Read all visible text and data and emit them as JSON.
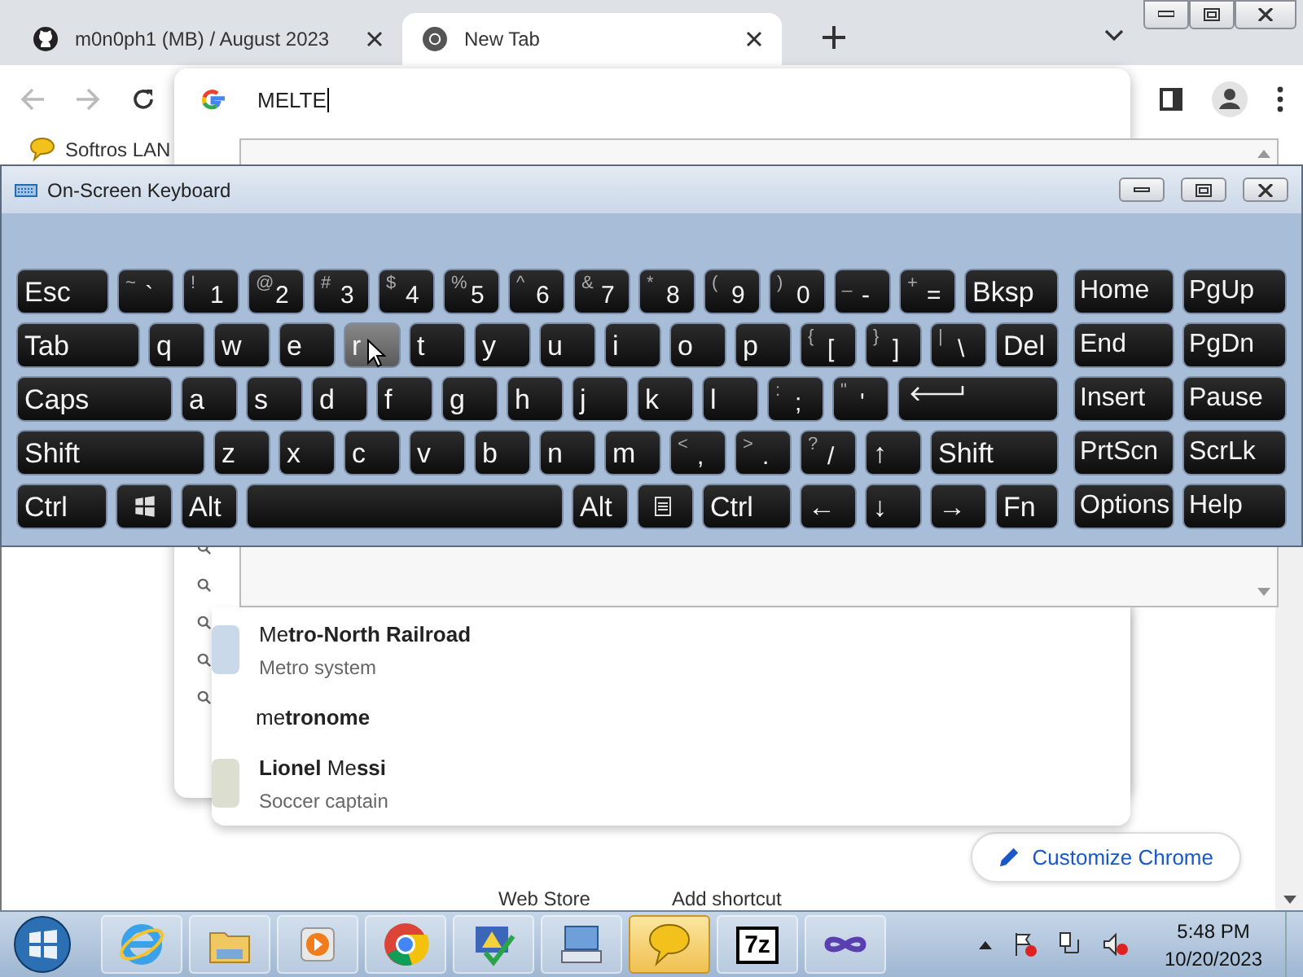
{
  "browser": {
    "tabs": [
      {
        "title": "m0n0ph1 (MB) / August 2023",
        "selected": false
      },
      {
        "title": "New Tab",
        "selected": true
      }
    ],
    "omnibox": {
      "value": "MELTE"
    },
    "bookmarks": [
      {
        "label": "Softros LAN"
      }
    ],
    "suggestions": [
      {
        "kind": "entity",
        "title": "Me**tro-North Railroad**",
        "subtitle": "Metro system",
        "color": "#c9d9ea"
      },
      {
        "kind": "search",
        "title": "me**tronome**"
      },
      {
        "kind": "entity",
        "title": "**Lionel** Me**ssi**",
        "subtitle": "Soccer captain",
        "color": "#dcdfd0"
      }
    ],
    "customize_button": "Customize Chrome",
    "shortcuts": [
      {
        "label": "Web Store"
      },
      {
        "label": "Add shortcut"
      }
    ]
  },
  "keyboard": {
    "title": "On-Screen Keyboard",
    "rows": [
      {
        "keys": [
          {
            "label": "Esc",
            "hovered": false
          },
          {
            "label": "`",
            "shift": "~",
            "hovered": false
          },
          {
            "label": "1",
            "shift": "!",
            "hovered": false
          },
          {
            "label": "2",
            "shift": "@",
            "hovered": false
          },
          {
            "label": "3",
            "shift": "#",
            "hovered": false
          },
          {
            "label": "4",
            "shift": "$",
            "hovered": false
          },
          {
            "label": "5",
            "shift": "%",
            "hovered": false
          },
          {
            "label": "6",
            "shift": "^",
            "hovered": false
          },
          {
            "label": "7",
            "shift": "&",
            "hovered": false
          },
          {
            "label": "8",
            "shift": "*",
            "hovered": false
          },
          {
            "label": "9",
            "shift": "(",
            "hovered": false
          },
          {
            "label": "0",
            "shift": ")",
            "hovered": false
          },
          {
            "label": "-",
            "shift": "_",
            "hovered": false
          },
          {
            "label": "=",
            "shift": "+",
            "hovered": false
          },
          {
            "label": "Bksp",
            "hovered": false
          }
        ]
      },
      {
        "keys": [
          {
            "label": "Tab",
            "hovered": false
          },
          {
            "label": "q",
            "hovered": false
          },
          {
            "label": "w",
            "hovered": false
          },
          {
            "label": "e",
            "hovered": false
          },
          {
            "label": "r",
            "hovered": true
          },
          {
            "label": "t",
            "hovered": false
          },
          {
            "label": "y",
            "hovered": false
          },
          {
            "label": "u",
            "hovered": false
          },
          {
            "label": "i",
            "hovered": false
          },
          {
            "label": "o",
            "hovered": false
          },
          {
            "label": "p",
            "hovered": false
          },
          {
            "label": "[",
            "shift": "{",
            "hovered": false
          },
          {
            "label": "]",
            "shift": "}",
            "hovered": false
          },
          {
            "label": "\\",
            "shift": "|",
            "hovered": false
          },
          {
            "label": "Del",
            "hovered": false
          }
        ]
      },
      {
        "keys": [
          {
            "label": "Caps",
            "hovered": false
          },
          {
            "label": "a",
            "hovered": false
          },
          {
            "label": "s",
            "hovered": false
          },
          {
            "label": "d",
            "hovered": false
          },
          {
            "label": "f",
            "hovered": false
          },
          {
            "label": "g",
            "hovered": false
          },
          {
            "label": "h",
            "hovered": false
          },
          {
            "label": "j",
            "hovered": false
          },
          {
            "label": "k",
            "hovered": false
          },
          {
            "label": "l",
            "hovered": false
          },
          {
            "label": ";",
            "shift": ":",
            "hovered": false
          },
          {
            "label": "'",
            "shift": "\"",
            "hovered": false
          },
          {
            "kind": "enter",
            "hovered": false
          }
        ]
      },
      {
        "keys": [
          {
            "label": "Shift",
            "hovered": false
          },
          {
            "label": "z",
            "hovered": false
          },
          {
            "label": "x",
            "hovered": false
          },
          {
            "label": "c",
            "hovered": false
          },
          {
            "label": "v",
            "hovered": false
          },
          {
            "label": "b",
            "hovered": false
          },
          {
            "label": "n",
            "hovered": false
          },
          {
            "label": "m",
            "hovered": false
          },
          {
            "label": ",",
            "shift": "<",
            "hovered": false
          },
          {
            "label": ".",
            "shift": ">",
            "hovered": false
          },
          {
            "label": "/",
            "shift": "?",
            "hovered": false
          },
          {
            "label": "↑",
            "hovered": false
          },
          {
            "label": "Shift",
            "hovered": false
          }
        ]
      },
      {
        "keys": [
          {
            "label": "Ctrl",
            "hovered": false
          },
          {
            "kind": "win",
            "hovered": false
          },
          {
            "label": "Alt",
            "hovered": false
          },
          {
            "kind": "space",
            "hovered": false
          },
          {
            "label": "Alt",
            "hovered": false
          },
          {
            "kind": "menu",
            "hovered": false
          },
          {
            "label": "Ctrl",
            "hovered": false
          },
          {
            "label": "←",
            "hovered": false
          },
          {
            "label": "↓",
            "hovered": false
          },
          {
            "label": "→",
            "hovered": false
          },
          {
            "label": "Fn",
            "hovered": false
          }
        ]
      }
    ],
    "side_rows": [
      [
        {
          "label": "Home",
          "hovered": false
        },
        {
          "label": "PgUp",
          "hovered": false
        }
      ],
      [
        {
          "label": "End",
          "hovered": false
        },
        {
          "label": "PgDn",
          "hovered": false
        }
      ],
      [
        {
          "label": "Insert",
          "hovered": false
        },
        {
          "label": "Pause",
          "hovered": false
        }
      ],
      [
        {
          "label": "PrtScn",
          "hovered": false
        },
        {
          "label": "ScrLk",
          "hovered": false
        }
      ],
      [
        {
          "label": "Options",
          "hovered": false
        },
        {
          "label": "Help",
          "hovered": false
        }
      ]
    ]
  },
  "taskbar": {
    "apps": [
      {
        "kind": "ie",
        "selected": false
      },
      {
        "kind": "folder",
        "selected": false
      },
      {
        "kind": "media",
        "selected": false
      },
      {
        "kind": "chrome",
        "selected": false
      },
      {
        "kind": "security",
        "selected": false
      },
      {
        "kind": "keyboard",
        "selected": false
      },
      {
        "kind": "chat",
        "selected": true
      },
      {
        "kind": "zip",
        "label": "7z",
        "selected": false
      },
      {
        "kind": "infinity",
        "selected": false
      }
    ],
    "time": "5:48 PM",
    "date": "10/20/2023"
  }
}
